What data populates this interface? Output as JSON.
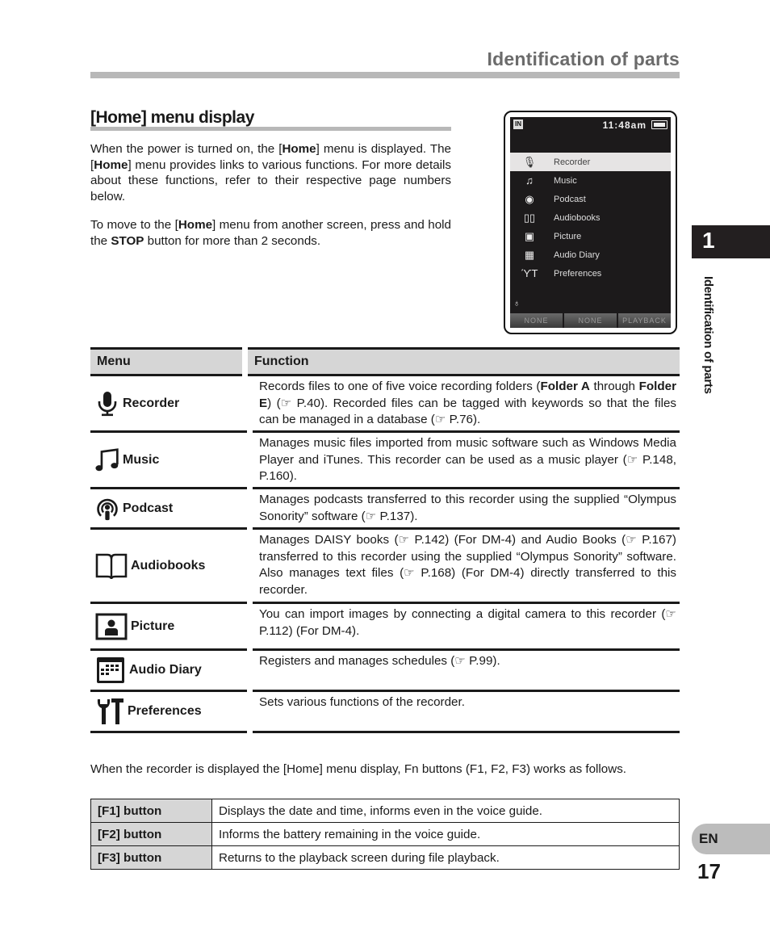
{
  "header": {
    "title": "Identification of parts"
  },
  "section": {
    "title": "[Home] menu display",
    "paragraph1": {
      "parts": [
        "When the power is turned on, the [",
        "Home",
        "] menu is displayed. The [",
        "Home",
        "] menu provides links to various functions. For more details about these functions, refer to their respective page numbers below."
      ]
    },
    "paragraph2": {
      "parts": [
        "To move to the [",
        "Home",
        "] menu from another screen, press and hold the ",
        "STOP",
        " button for more than 2 seconds."
      ]
    }
  },
  "device_screen": {
    "status_in": "IN",
    "time": "11:48am",
    "items": [
      {
        "label": "Recorder",
        "icon": "mic-icon",
        "selected": true
      },
      {
        "label": "Music",
        "icon": "music-note-icon",
        "selected": false
      },
      {
        "label": "Podcast",
        "icon": "podcast-icon",
        "selected": false
      },
      {
        "label": "Audiobooks",
        "icon": "book-icon",
        "selected": false
      },
      {
        "label": "Picture",
        "icon": "picture-icon",
        "selected": false
      },
      {
        "label": "Audio Diary",
        "icon": "calendar-icon",
        "selected": false
      },
      {
        "label": "Preferences",
        "icon": "tools-icon",
        "selected": false
      }
    ],
    "fn_buttons": [
      "NONE",
      "NONE",
      "PLAYBACK"
    ]
  },
  "side_tab": {
    "chapter_number": "1",
    "chapter_label": "Identification of parts"
  },
  "menu_table": {
    "headers": [
      "Menu",
      "Function"
    ],
    "rows": [
      {
        "menu": "Recorder",
        "icon": "mic-icon",
        "function_parts": [
          "Records files to one of five voice recording folders (",
          "Folder A",
          " through ",
          "Folder E",
          ") (☞ P.40). Recorded files can be tagged with keywords so that the files can be managed in a database (☞ P.76)."
        ]
      },
      {
        "menu": "Music",
        "icon": "music-note-icon",
        "function": "Manages music files imported from music software such as Windows Media Player and iTunes. This recorder can be used as a music player (☞ P.148, P.160)."
      },
      {
        "menu": "Podcast",
        "icon": "podcast-icon",
        "function": "Manages podcasts transferred to this recorder using the supplied “Olympus Sonority” software (☞ P.137)."
      },
      {
        "menu": "Audiobooks",
        "icon": "book-icon",
        "function": "Manages DAISY books (☞ P.142) (For DM-4) and Audio Books (☞ P.167) transferred to this recorder using the supplied “Olympus Sonority” software. Also manages text files (☞ P.168) (For DM-4) directly transferred to this recorder."
      },
      {
        "menu": "Picture",
        "icon": "picture-icon",
        "function": "You can import images by connecting a digital camera to this recorder (☞ P.112) (For DM-4)."
      },
      {
        "menu": "Audio Diary",
        "icon": "calendar-icon",
        "function": "Registers and manages schedules (☞ P.99)."
      },
      {
        "menu": "Preferences",
        "icon": "tools-icon",
        "function": "Sets various functions of the recorder."
      }
    ]
  },
  "fn_section": {
    "intro": "When the recorder is displayed the [Home] menu display, Fn buttons (F1, F2, F3) works as follows.",
    "rows": [
      {
        "button": "[F1] button",
        "description": "Displays the date and time, informs even in the voice guide."
      },
      {
        "button": "[F2] button",
        "description": "Informs the battery remaining in the voice guide."
      },
      {
        "button": "[F3] button",
        "description": "Returns to the playback screen during file playback."
      }
    ]
  },
  "footer": {
    "language": "EN",
    "page_number": "17"
  }
}
